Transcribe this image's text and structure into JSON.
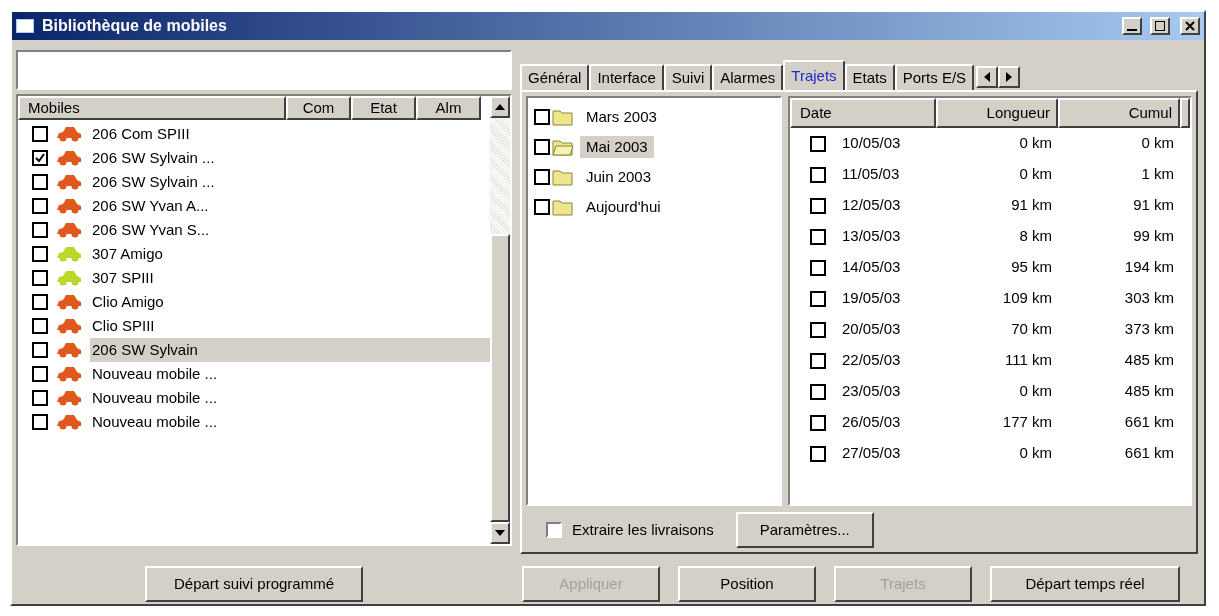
{
  "window": {
    "title": "Bibliothèque de mobiles"
  },
  "mobiles": {
    "columns": [
      "Mobiles",
      "Com",
      "Etat",
      "Alm"
    ],
    "rows": [
      {
        "name": "206 Com SPIII",
        "checked": false,
        "selected": false,
        "color": "#e0581c"
      },
      {
        "name": "206 SW Sylvain ...",
        "checked": true,
        "selected": false,
        "color": "#e0581c"
      },
      {
        "name": "206 SW Sylvain ...",
        "checked": false,
        "selected": false,
        "color": "#e0581c"
      },
      {
        "name": "206 SW Yvan A...",
        "checked": false,
        "selected": false,
        "color": "#e0581c"
      },
      {
        "name": "206 SW Yvan S...",
        "checked": false,
        "selected": false,
        "color": "#e0581c"
      },
      {
        "name": "307 Amigo",
        "checked": false,
        "selected": false,
        "color": "#bcd62a"
      },
      {
        "name": "307 SPIII",
        "checked": false,
        "selected": false,
        "color": "#bcd62a"
      },
      {
        "name": "Clio Amigo",
        "checked": false,
        "selected": false,
        "color": "#e0581c"
      },
      {
        "name": "Clio SPIII",
        "checked": false,
        "selected": false,
        "color": "#e0581c"
      },
      {
        "name": "206 SW Sylvain",
        "checked": false,
        "selected": true,
        "color": "#e0581c"
      },
      {
        "name": "Nouveau mobile ...",
        "checked": false,
        "selected": false,
        "color": "#e0581c"
      },
      {
        "name": "Nouveau mobile ...",
        "checked": false,
        "selected": false,
        "color": "#e0581c"
      },
      {
        "name": "Nouveau mobile ...",
        "checked": false,
        "selected": false,
        "color": "#e0581c"
      }
    ],
    "button": {
      "label": "Départ suivi programmé",
      "disabled": false
    }
  },
  "tabs": [
    {
      "label": "Général",
      "selected": false
    },
    {
      "label": "Interface",
      "selected": false
    },
    {
      "label": "Suivi",
      "selected": false
    },
    {
      "label": "Alarmes",
      "selected": false
    },
    {
      "label": "Trajets",
      "selected": true
    },
    {
      "label": "Etats",
      "selected": false
    },
    {
      "label": "Ports E/S",
      "selected": false
    }
  ],
  "months": [
    {
      "label": "Mars 2003",
      "checked": false,
      "selected": false,
      "expanded": false
    },
    {
      "label": "Mai 2003",
      "checked": false,
      "selected": true,
      "expanded": true
    },
    {
      "label": "Juin 2003",
      "checked": false,
      "selected": false,
      "expanded": false
    },
    {
      "label": "Aujourd'hui",
      "checked": false,
      "selected": false,
      "expanded": false
    }
  ],
  "trips": {
    "columns": [
      "Date",
      "Longueur",
      "Cumul"
    ],
    "rows": [
      {
        "date": "10/05/03",
        "length": "0 km",
        "total": "0 km",
        "checked": false
      },
      {
        "date": "11/05/03",
        "length": "0 km",
        "total": "1 km",
        "checked": false
      },
      {
        "date": "12/05/03",
        "length": "91 km",
        "total": "91 km",
        "checked": false
      },
      {
        "date": "13/05/03",
        "length": "8 km",
        "total": "99 km",
        "checked": false
      },
      {
        "date": "14/05/03",
        "length": "95 km",
        "total": "194 km",
        "checked": false
      },
      {
        "date": "19/05/03",
        "length": "109 km",
        "total": "303 km",
        "checked": false
      },
      {
        "date": "20/05/03",
        "length": "70 km",
        "total": "373 km",
        "checked": false
      },
      {
        "date": "22/05/03",
        "length": "111 km",
        "total": "485 km",
        "checked": false
      },
      {
        "date": "23/05/03",
        "length": "0 km",
        "total": "485 km",
        "checked": false
      },
      {
        "date": "26/05/03",
        "length": "177 km",
        "total": "661 km",
        "checked": false
      },
      {
        "date": "27/05/03",
        "length": "0 km",
        "total": "661 km",
        "checked": false
      }
    ]
  },
  "extract": {
    "label": "Extraire les livraisons",
    "checked": false
  },
  "params_button": {
    "label": "Paramètres...",
    "disabled": false
  },
  "buttons": [
    {
      "label": "Appliquer",
      "disabled": true
    },
    {
      "label": "Position",
      "disabled": false
    },
    {
      "label": "Trajets",
      "disabled": true
    },
    {
      "label": "Départ temps réel",
      "disabled": false
    }
  ]
}
